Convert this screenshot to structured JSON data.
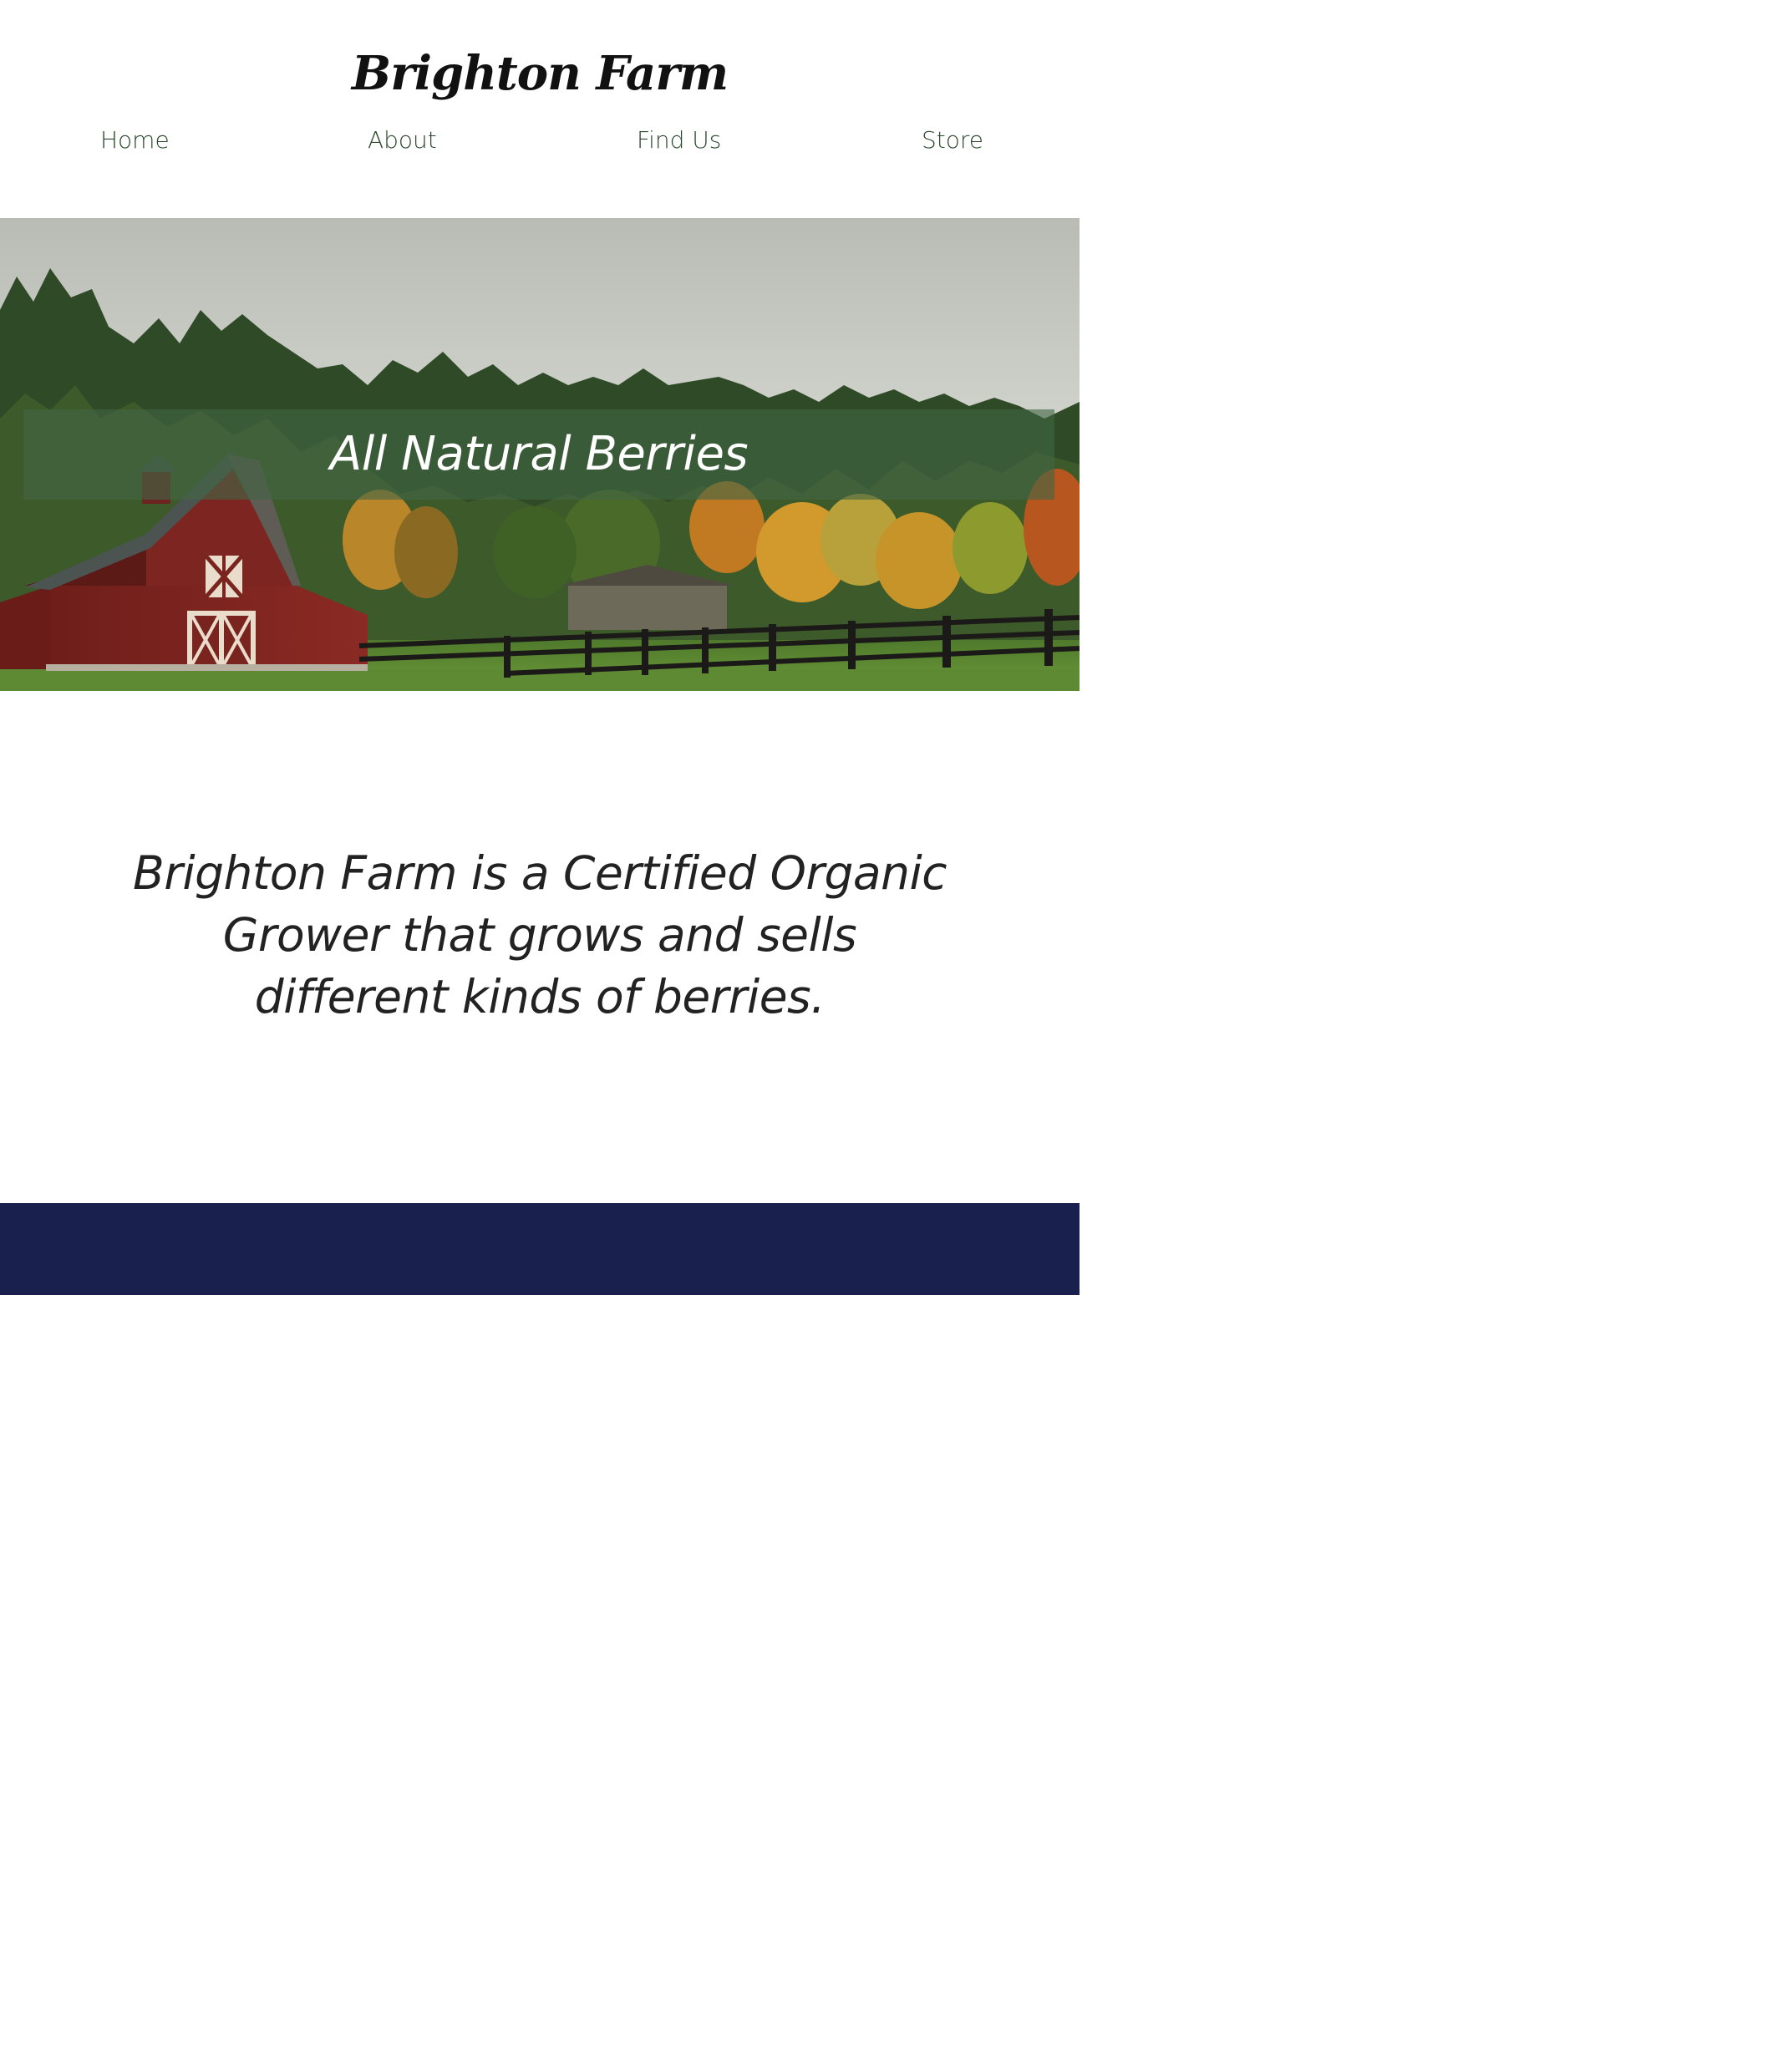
{
  "header": {
    "site_title": "Brighton Farm"
  },
  "nav": {
    "items": [
      {
        "label": "Home"
      },
      {
        "label": "About"
      },
      {
        "label": "Find Us"
      },
      {
        "label": "Store"
      }
    ]
  },
  "hero": {
    "heading": "All Natural Berries",
    "image": "red-barn-autumn-forest-photo"
  },
  "intro": {
    "text": "Brighton Farm is a Certified Organic Grower that grows and sells different kinds of berries."
  },
  "colors": {
    "nav_text": "#2b4a2c",
    "banner_overlay": "#426543",
    "footer_band": "#19204d",
    "body_text": "#222222"
  }
}
